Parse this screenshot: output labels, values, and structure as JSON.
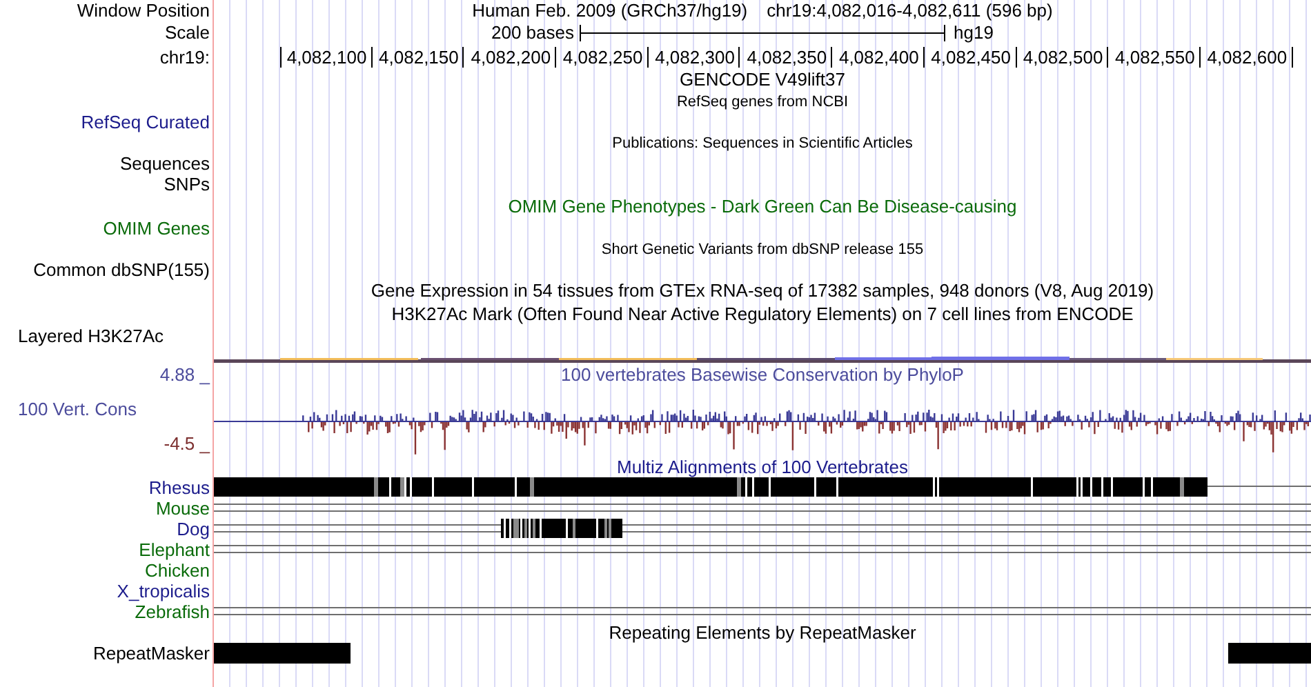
{
  "header": {
    "window_label": "Window Position",
    "assembly": "Human Feb. 2009 (GRCh37/hg19)",
    "position": "chr19:4,082,016-4,082,611 (596 bp)",
    "scale_label": "Scale",
    "scale_text": "200 bases",
    "scale_db": "hg19",
    "chrom_label": "chr19:",
    "ruler_ticks": [
      "4,082,100",
      "4,082,150",
      "4,082,200",
      "4,082,250",
      "4,082,300",
      "4,082,350",
      "4,082,400",
      "4,082,450",
      "4,082,500",
      "4,082,550",
      "4,082,600"
    ]
  },
  "tracks": [
    {
      "kind": "heading",
      "title": "GENCODE V49lift37"
    },
    {
      "kind": "note",
      "title": "RefSeq genes from NCBI",
      "label_lines": [
        "RefSeq Curated"
      ],
      "color": "#1c1c8c"
    },
    {
      "kind": "note",
      "title": "Publications: Sequences in Scientific Articles",
      "label_lines": [
        "Sequences",
        "SNPs"
      ],
      "color": "#000000"
    },
    {
      "kind": "heading",
      "title": "OMIM Gene Phenotypes - Dark Green Can Be Disease-causing",
      "label_lines": [
        "OMIM Genes"
      ],
      "color": "#0a6b0a"
    },
    {
      "kind": "note",
      "title": "Short Genetic Variants from dbSNP release 155",
      "label_lines": [
        "Common dbSNP(155)"
      ],
      "color": "#000000"
    },
    {
      "kind": "heading",
      "title": "Gene Expression in 54 tissues from GTEx RNA-seq of 17382 samples, 948 donors (V8, Aug 2019)"
    },
    {
      "kind": "signal",
      "title": "H3K27Ac Mark (Often Found Near Active Regulatory Elements) on 7 cell lines from ENCODE",
      "label_lines": [
        "Layered H3K27Ac"
      ],
      "color": "#000000"
    }
  ],
  "conservation": {
    "title": "100 vertebrates Basewise Conservation by PhyloP",
    "label": "100 Vert. Cons",
    "axis_max": "4.88 _",
    "axis_min": "-4.5 _"
  },
  "multiz": {
    "title": "Multiz Alignments of 100 Vertebrates",
    "species": [
      {
        "name": "Rhesus",
        "color": "#1c1c8c",
        "kind": "dense"
      },
      {
        "name": "Mouse",
        "color": "#0a6b0a",
        "kind": "lines"
      },
      {
        "name": "Dog",
        "color": "#1c1c8c",
        "kind": "partial"
      },
      {
        "name": "Elephant",
        "color": "#0a6b0a",
        "kind": "lines"
      },
      {
        "name": "Chicken",
        "color": "#0a6b0a",
        "kind": "empty"
      },
      {
        "name": "X_tropicalis",
        "color": "#1c1c8c",
        "kind": "empty"
      },
      {
        "name": "Zebrafish",
        "color": "#0a6b0a",
        "kind": "lines"
      }
    ]
  },
  "repeatmasker": {
    "title": "Repeating Elements by RepeatMasker",
    "label": "RepeatMasker"
  }
}
